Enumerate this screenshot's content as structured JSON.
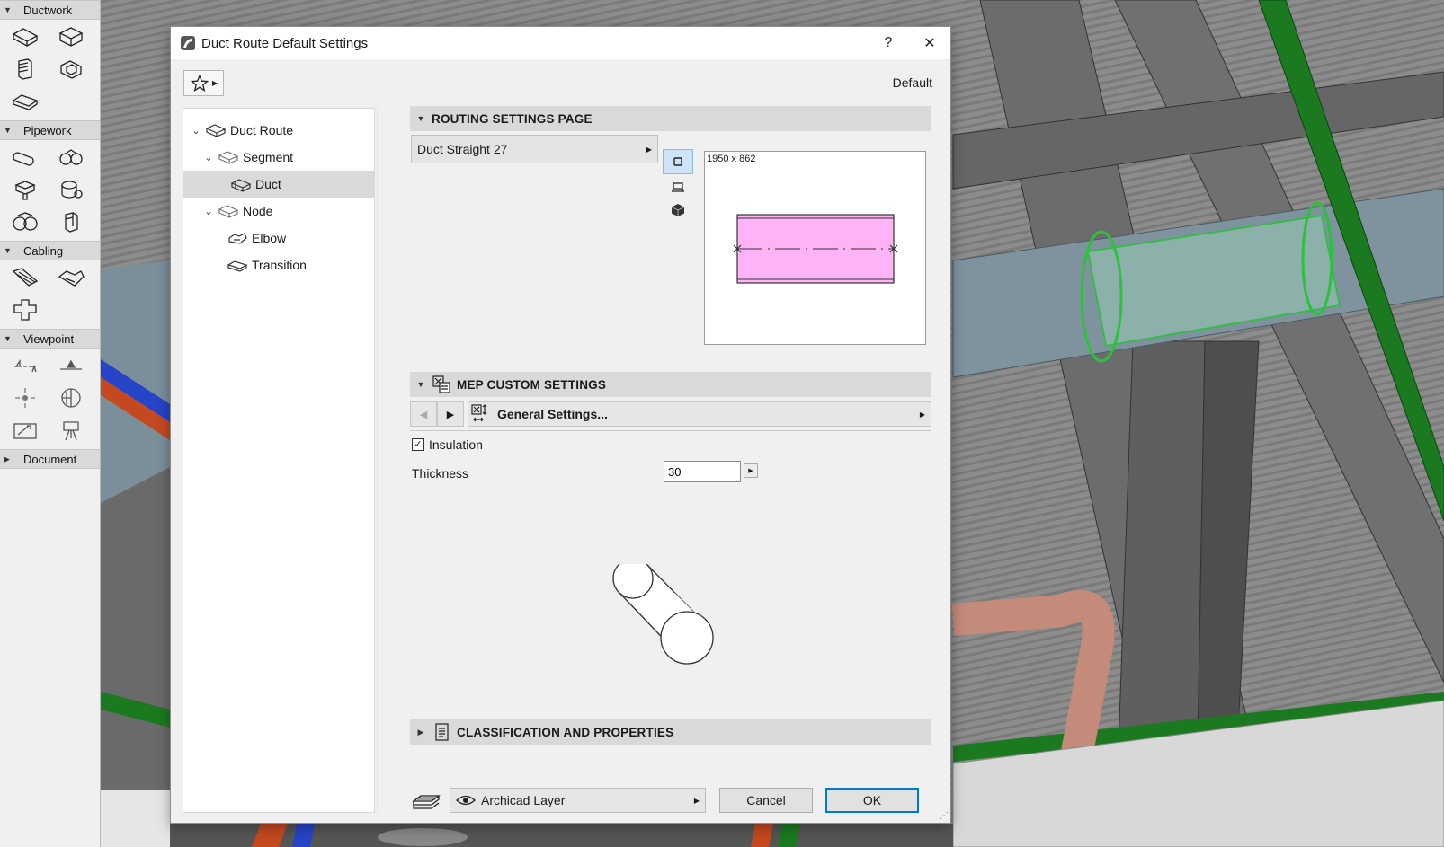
{
  "toolbox": {
    "sections": [
      {
        "label": "Ductwork",
        "expanded": true
      },
      {
        "label": "Pipework",
        "expanded": true
      },
      {
        "label": "Cabling",
        "expanded": true
      },
      {
        "label": "Viewpoint",
        "expanded": true
      },
      {
        "label": "Document",
        "expanded": false
      }
    ]
  },
  "dialog": {
    "title": "Duct Route Default Settings",
    "help_label": "?",
    "close_label": "✕",
    "default_label": "Default",
    "tree": {
      "items": [
        {
          "label": "Duct Route",
          "level": 0,
          "expanded": true
        },
        {
          "label": "Segment",
          "level": 1,
          "expanded": true
        },
        {
          "label": "Duct",
          "level": 2,
          "selected": true
        },
        {
          "label": "Node",
          "level": 1,
          "expanded": true
        },
        {
          "label": "Elbow",
          "level": 2
        },
        {
          "label": "Transition",
          "level": 2
        }
      ]
    },
    "routing": {
      "header": "ROUTING SETTINGS PAGE",
      "type_value": "Duct Straight 27",
      "preview_dims": "1950 x 862",
      "preview_fill": "#ffb3f7"
    },
    "mep": {
      "header": "MEP CUSTOM SETTINGS",
      "page_label": "General Settings...",
      "insulation_label": "Insulation",
      "insulation_checked": true,
      "thickness_label": "Thickness",
      "thickness_value": "30"
    },
    "classification": {
      "header": "CLASSIFICATION AND PROPERTIES"
    },
    "footer": {
      "layer_value": "Archicad Layer",
      "cancel_label": "Cancel",
      "ok_label": "OK"
    }
  },
  "colors": {
    "accent": "#0078d7",
    "selected_row": "#dadada",
    "panel_header": "#d9d9d9"
  }
}
